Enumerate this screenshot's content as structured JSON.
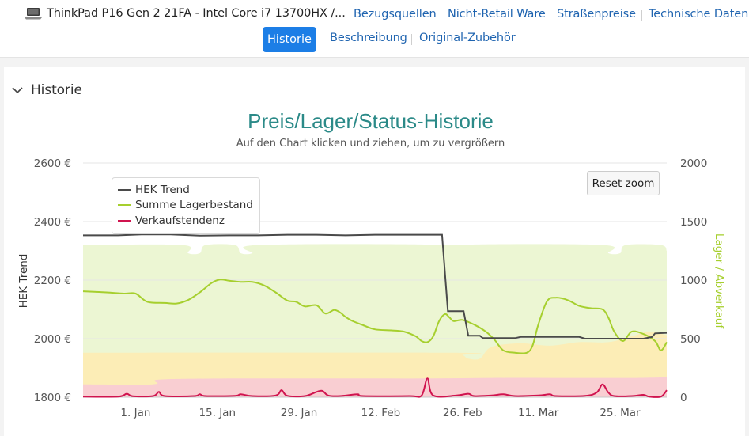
{
  "product": {
    "title": "ThinkPad P16 Gen 2 21FA - Intel Core i7 13700HX /...",
    "icon": "laptop-icon"
  },
  "nav": {
    "links": [
      {
        "label": "Bezugsquellen"
      },
      {
        "label": "Nicht-Retail Ware"
      },
      {
        "label": "Straßenpreise"
      },
      {
        "label": "Technische Daten"
      }
    ],
    "tabs": [
      {
        "label": "Historie",
        "active": true
      },
      {
        "label": "Beschreibung",
        "active": false
      },
      {
        "label": "Original-Zubehör",
        "active": false
      }
    ]
  },
  "section": {
    "title": "Historie",
    "icon": "chevron-down-icon"
  },
  "reset_zoom_label": "Reset zoom",
  "colors": {
    "accent": "#1c7ee6",
    "link": "#1f64b0",
    "title": "#2b8a88",
    "hek": "#4a4a4a",
    "stock": "#a6cf2e",
    "sales": "#d0144f",
    "band_green": "#ecf6d3",
    "band_yellow": "#fcedb6",
    "band_red": "#f9ced2"
  },
  "chart_data": {
    "type": "line",
    "title": "Preis/Lager/Status-Historie",
    "subtitle": "Auf den Chart klicken und ziehen, um zu vergrößern",
    "ylabel": "HEK Trend",
    "y2label": "Lager / Abverkauf",
    "ylim": [
      1800,
      2600
    ],
    "y2lim": [
      0,
      2000
    ],
    "yticks": [
      "1800 €",
      "2000 €",
      "2200 €",
      "2400 €",
      "2600 €"
    ],
    "y2ticks": [
      "0",
      "500",
      "1000",
      "1500",
      "2000"
    ],
    "xticks": [
      {
        "label": "1. Jan",
        "day": 9
      },
      {
        "label": "15. Jan",
        "day": 23
      },
      {
        "label": "29. Jan",
        "day": 37
      },
      {
        "label": "12. Feb",
        "day": 51
      },
      {
        "label": "26. Feb",
        "day": 65
      },
      {
        "label": "11. Mar",
        "day": 78
      },
      {
        "label": "25. Mar",
        "day": 92
      }
    ],
    "xrange": [
      0,
      100
    ],
    "legend": {
      "position": "top-left"
    },
    "series": [
      {
        "name": "HEK Trend",
        "axis": "left",
        "points": [
          [
            0,
            2353
          ],
          [
            6,
            2353
          ],
          [
            10,
            2356
          ],
          [
            15,
            2356
          ],
          [
            20,
            2352
          ],
          [
            25,
            2353
          ],
          [
            30,
            2353
          ],
          [
            35,
            2355
          ],
          [
            40,
            2355
          ],
          [
            45,
            2353
          ],
          [
            50,
            2355
          ],
          [
            55,
            2355
          ],
          [
            60,
            2355
          ],
          [
            61.5,
            2355
          ],
          [
            62.5,
            2094
          ],
          [
            65.2,
            2094
          ],
          [
            66,
            2010
          ],
          [
            68,
            2010
          ],
          [
            68.5,
            2002
          ],
          [
            74,
            2002
          ],
          [
            75,
            2006
          ],
          [
            85,
            2006
          ],
          [
            86,
            2000
          ],
          [
            96,
            2000
          ],
          [
            97.5,
            2006
          ],
          [
            98,
            2018
          ],
          [
            100,
            2020
          ]
        ]
      },
      {
        "name": "Summe Lagerbestand",
        "axis": "right",
        "points": [
          [
            0,
            905
          ],
          [
            4,
            895
          ],
          [
            7,
            885
          ],
          [
            9,
            885
          ],
          [
            11,
            815
          ],
          [
            14,
            805
          ],
          [
            16,
            800
          ],
          [
            18,
            830
          ],
          [
            20,
            895
          ],
          [
            22,
            975
          ],
          [
            23.5,
            1005
          ],
          [
            25,
            995
          ],
          [
            27,
            985
          ],
          [
            29,
            985
          ],
          [
            31,
            955
          ],
          [
            33,
            895
          ],
          [
            35,
            825
          ],
          [
            36.5,
            815
          ],
          [
            38,
            775
          ],
          [
            40,
            785
          ],
          [
            41.5,
            715
          ],
          [
            43,
            745
          ],
          [
            44,
            725
          ],
          [
            45,
            685
          ],
          [
            46,
            655
          ],
          [
            48,
            615
          ],
          [
            50,
            580
          ],
          [
            53,
            570
          ],
          [
            55,
            560
          ],
          [
            57,
            520
          ],
          [
            58,
            480
          ],
          [
            59,
            470
          ],
          [
            60,
            520
          ],
          [
            61,
            650
          ],
          [
            62,
            710
          ],
          [
            62.8,
            680
          ],
          [
            63.5,
            650
          ],
          [
            65,
            660
          ],
          [
            67,
            620
          ],
          [
            69,
            560
          ],
          [
            70.5,
            490
          ],
          [
            72,
            400
          ],
          [
            74,
            380
          ],
          [
            76,
            380
          ],
          [
            77,
            440
          ],
          [
            78,
            620
          ],
          [
            79.5,
            820
          ],
          [
            81,
            850
          ],
          [
            83,
            830
          ],
          [
            85,
            780
          ],
          [
            87,
            760
          ],
          [
            89,
            750
          ],
          [
            90,
            680
          ],
          [
            91,
            560
          ],
          [
            92.5,
            480
          ],
          [
            94,
            560
          ],
          [
            96,
            540
          ],
          [
            98,
            480
          ],
          [
            99,
            400
          ],
          [
            100,
            470
          ]
        ]
      },
      {
        "name": "Verkaufstendenz",
        "axis": "right",
        "points": [
          [
            0,
            5
          ],
          [
            6,
            5
          ],
          [
            7.5,
            30
          ],
          [
            8.5,
            8
          ],
          [
            12,
            10
          ],
          [
            13,
            45
          ],
          [
            14,
            10
          ],
          [
            19,
            10
          ],
          [
            20,
            25
          ],
          [
            21,
            10
          ],
          [
            26,
            12
          ],
          [
            27,
            25
          ],
          [
            29,
            10
          ],
          [
            33,
            15
          ],
          [
            34,
            60
          ],
          [
            35,
            12
          ],
          [
            38,
            10
          ],
          [
            40,
            45
          ],
          [
            41,
            55
          ],
          [
            42,
            15
          ],
          [
            44,
            10
          ],
          [
            47,
            25
          ],
          [
            48,
            10
          ],
          [
            56,
            10
          ],
          [
            58,
            15
          ],
          [
            59,
            160
          ],
          [
            60,
            15
          ],
          [
            64,
            15
          ],
          [
            66,
            30
          ],
          [
            67,
            10
          ],
          [
            70,
            15
          ],
          [
            72,
            25
          ],
          [
            74,
            10
          ],
          [
            78,
            15
          ],
          [
            80,
            25
          ],
          [
            81,
            10
          ],
          [
            86,
            12
          ],
          [
            88,
            40
          ],
          [
            89,
            110
          ],
          [
            90,
            40
          ],
          [
            91,
            10
          ],
          [
            94,
            10
          ],
          [
            96,
            20
          ],
          [
            97,
            5
          ],
          [
            99,
            5
          ],
          [
            100,
            60
          ]
        ]
      }
    ],
    "bands": {
      "green_top": [
        [
          0,
          1300
        ],
        [
          17,
          1300
        ],
        [
          18,
          1230
        ],
        [
          20,
          1230
        ],
        [
          21,
          1300
        ],
        [
          26,
          1300
        ],
        [
          27,
          1230
        ],
        [
          29,
          1230
        ],
        [
          30,
          1300
        ],
        [
          62,
          1300
        ],
        [
          63,
          1240
        ],
        [
          64,
          1300
        ],
        [
          89,
          1300
        ],
        [
          90,
          1230
        ],
        [
          92,
          1230
        ],
        [
          93,
          1300
        ],
        [
          99,
          1300
        ],
        [
          100,
          1250
        ]
      ],
      "yellow_top": [
        [
          0,
          380
        ],
        [
          63,
          380
        ],
        [
          65,
          360
        ],
        [
          66,
          330
        ],
        [
          68,
          330
        ],
        [
          70,
          430
        ],
        [
          75,
          460
        ],
        [
          80,
          440
        ],
        [
          85,
          470
        ],
        [
          90,
          470
        ],
        [
          94,
          520
        ],
        [
          97,
          560
        ],
        [
          100,
          530
        ]
      ],
      "red_top": [
        [
          0,
          110
        ],
        [
          12,
          110
        ],
        [
          13,
          150
        ],
        [
          25,
          160
        ],
        [
          40,
          160
        ],
        [
          50,
          160
        ],
        [
          60,
          160
        ],
        [
          70,
          165
        ],
        [
          80,
          165
        ],
        [
          90,
          165
        ],
        [
          95,
          165
        ],
        [
          100,
          170
        ]
      ]
    }
  }
}
